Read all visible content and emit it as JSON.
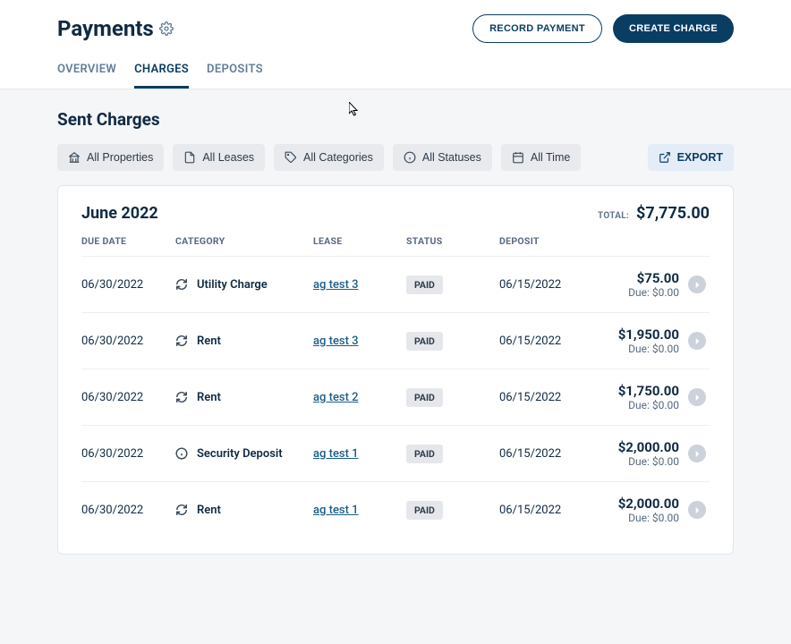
{
  "header": {
    "title": "Payments",
    "actions": {
      "record_payment": "RECORD PAYMENT",
      "create_charge": "CREATE CHARGE"
    },
    "tabs": [
      {
        "label": "OVERVIEW",
        "active": false
      },
      {
        "label": "CHARGES",
        "active": true
      },
      {
        "label": "DEPOSITS",
        "active": false
      }
    ]
  },
  "section_title": "Sent Charges",
  "filters": {
    "properties": "All Properties",
    "leases": "All Leases",
    "categories": "All Categories",
    "statuses": "All Statuses",
    "time": "All Time",
    "export": "EXPORT"
  },
  "panel": {
    "month": "June 2022",
    "total_label": "TOTAL:",
    "total_amount": "$7,775.00",
    "columns": {
      "due_date": "DUE DATE",
      "category": "CATEGORY",
      "lease": "LEASE",
      "status": "STATUS",
      "deposit": "DEPOSIT"
    },
    "due_prefix": "Due: ",
    "rows": [
      {
        "due_date": "06/30/2022",
        "category": "Utility Charge",
        "icon": "recurring",
        "lease": "ag test 3",
        "status": "PAID",
        "deposit": "06/15/2022",
        "amount": "$75.00",
        "due": "$0.00"
      },
      {
        "due_date": "06/30/2022",
        "category": "Rent",
        "icon": "recurring",
        "lease": "ag test 3",
        "status": "PAID",
        "deposit": "06/15/2022",
        "amount": "$1,950.00",
        "due": "$0.00"
      },
      {
        "due_date": "06/30/2022",
        "category": "Rent",
        "icon": "recurring",
        "lease": "ag test 2",
        "status": "PAID",
        "deposit": "06/15/2022",
        "amount": "$1,750.00",
        "due": "$0.00"
      },
      {
        "due_date": "06/30/2022",
        "category": "Security Deposit",
        "icon": "info",
        "lease": "ag test 1",
        "status": "PAID",
        "deposit": "06/15/2022",
        "amount": "$2,000.00",
        "due": "$0.00"
      },
      {
        "due_date": "06/30/2022",
        "category": "Rent",
        "icon": "recurring",
        "lease": "ag test 1",
        "status": "PAID",
        "deposit": "06/15/2022",
        "amount": "$2,000.00",
        "due": "$0.00"
      }
    ]
  }
}
